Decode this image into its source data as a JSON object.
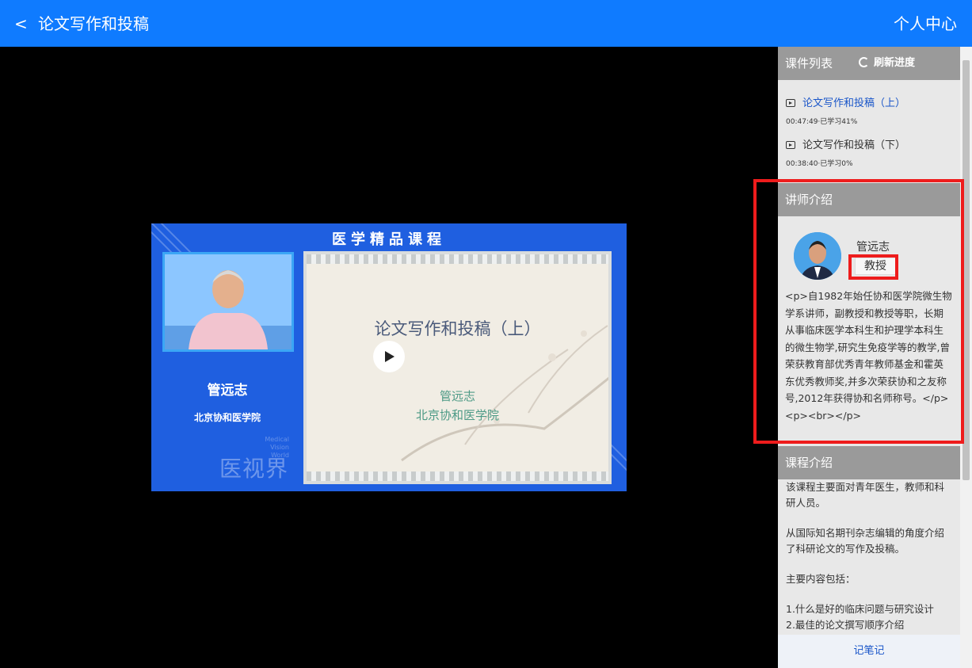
{
  "header": {
    "back_icon": "chevron-left-icon",
    "back_glyph": "<",
    "title": "论文写作和投稿",
    "personal_center": "个人中心"
  },
  "video": {
    "banner": "医学精品课程",
    "lecturer_name": "管远志",
    "lecturer_institution": "北京协和医学院",
    "watermark_en_line1": "Medical",
    "watermark_en_line2": "Vision World",
    "watermark_cn": "医视界",
    "slide_title": "论文写作和投稿（上）",
    "slide_lecturer": "管远志",
    "slide_institution": "北京协和医学院",
    "play_icon": "play-icon"
  },
  "sidebar": {
    "courseware_header": "课件列表",
    "refresh_label": "刷新进度",
    "refresh_icon": "refresh-icon",
    "courses": [
      {
        "title": "论文写作和投稿（上）",
        "meta": "00:47:49·已学习41%",
        "active": true
      },
      {
        "title": "论文写作和投稿（下）",
        "meta": "00:38:40·已学习0%",
        "active": false
      }
    ],
    "teacher_header": "讲师介绍",
    "teacher_name": "管远志",
    "teacher_title": "教授",
    "teacher_bio": "<p>自1982年始任协和医学院微生物学系讲师，副教授和教授等职，长期从事临床医学本科生和护理学本科生的微生物学,研究生免疫学等的教学,曾荣获教育部优秀青年教师基金和霍英东优秀教师奖,并多次荣获协和之友称号,2012年获得协和名师称号。</p><p><br></p>",
    "course_header": "课程介绍",
    "course_intro": {
      "p1": "该课程主要面对青年医生，教师和科研人员。",
      "p2": "从国际知名期刊杂志编辑的角度介绍了科研论文的写作及投稿。",
      "p3": "主要内容包括：",
      "item1": "1.什么是好的临床问题与研究设计",
      "item2": "2.最佳的论文撰写顺序介绍"
    },
    "notes_button": "记笔记"
  },
  "colors": {
    "header_bg": "#0f7bff",
    "section_header_bg": "#9a9a9a",
    "sidebar_bg": "#e8e8e8",
    "highlight": "#ee1c1c",
    "active_link": "#1a56c9"
  }
}
